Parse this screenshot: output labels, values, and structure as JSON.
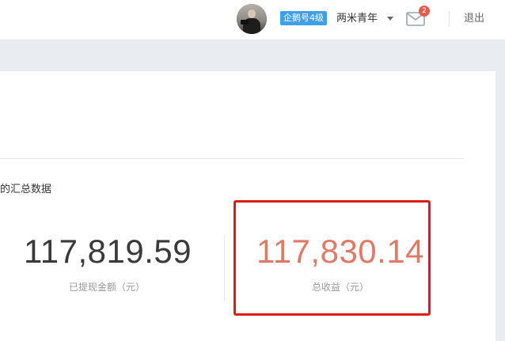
{
  "header": {
    "level_badge": "企鹅号4级",
    "username": "两米青年",
    "mail_count": "2",
    "logout_label": "退出",
    "icons": {
      "avatar": "avatar",
      "dropdown": "caret-down-icon",
      "mail": "envelope-icon"
    }
  },
  "summary": {
    "section_title": "的汇总数据",
    "withdrawn": {
      "value": "117,819.59",
      "label": "已提现金额（元）"
    },
    "total": {
      "value": "117,830.14",
      "label": "总收益（元）"
    }
  },
  "colors": {
    "accent": "#3fa0e8",
    "total_value": "#e07a68",
    "highlight_border": "#e01919",
    "mail_badge": "#e35d4f"
  }
}
